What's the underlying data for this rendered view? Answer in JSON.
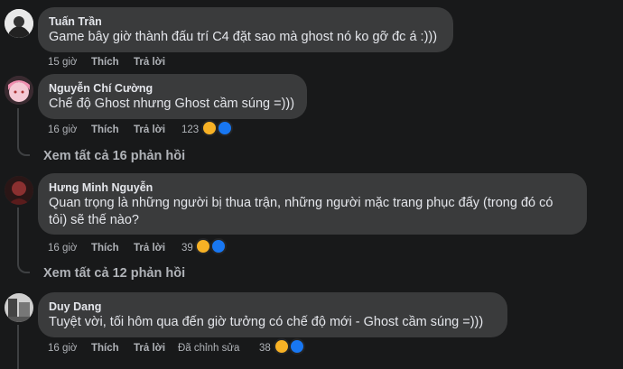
{
  "comments": [
    {
      "author": "Tuấn Trần",
      "text": "Game bây giờ thành đấu trí C4 đặt sao mà ghost nó ko gỡ đc á :)))",
      "time": "15 giờ",
      "like_label": "Thích",
      "reply_label": "Trả lời"
    },
    {
      "author": "Nguyễn Chí Cường",
      "text": "Chế độ Ghost nhưng Ghost cầm súng =)))",
      "time": "16 giờ",
      "like_label": "Thích",
      "reply_label": "Trả lời",
      "reactions": "123",
      "view_replies": "Xem tất cả 16 phản hồi"
    },
    {
      "author": "Hưng Minh Nguyễn",
      "text_line1": "Quan trọng là những người bị thua trận, những người mặc trang phục đấy (trong đó có",
      "text_line2": "tôi) sẽ thế nào?",
      "time": "16 giờ",
      "like_label": "Thích",
      "reply_label": "Trả lời",
      "reactions": "39",
      "view_replies": "Xem tất cả 12 phản hồi"
    },
    {
      "author": "Duy Dang",
      "text": "Tuyệt vời, tối hôm qua đến giờ tưởng có chế độ mới - Ghost cầm súng =)))",
      "time": "16 giờ",
      "like_label": "Thích",
      "reply_label": "Trả lời",
      "edited_label": "Đã chỉnh sửa",
      "reactions": "38"
    }
  ],
  "colors": {
    "background": "#18191a",
    "bubble": "#3a3b3c",
    "primary_text": "#e4e6eb",
    "secondary_text": "#b0b3b8",
    "haha": "#f7b125",
    "like": "#1877f2"
  },
  "icons": [
    "haha-reaction-icon",
    "like-reaction-icon"
  ]
}
